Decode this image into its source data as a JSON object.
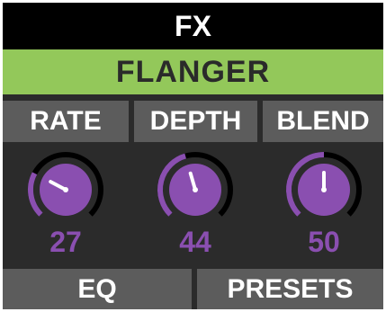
{
  "header": {
    "title": "FX",
    "effect": "FLANGER"
  },
  "params": [
    {
      "label": "RATE",
      "value": "27",
      "level": 0.27
    },
    {
      "label": "DEPTH",
      "value": "44",
      "level": 0.44
    },
    {
      "label": "BLEND",
      "value": "50",
      "level": 0.5
    }
  ],
  "footer": {
    "eq": "EQ",
    "presets": "PRESETS"
  },
  "colors": {
    "accent": "#8a4fb0",
    "effect_bar": "#93c85a",
    "panel": "#2b2b2b",
    "button": "#5c5c5c",
    "title_bar": "#000000"
  }
}
